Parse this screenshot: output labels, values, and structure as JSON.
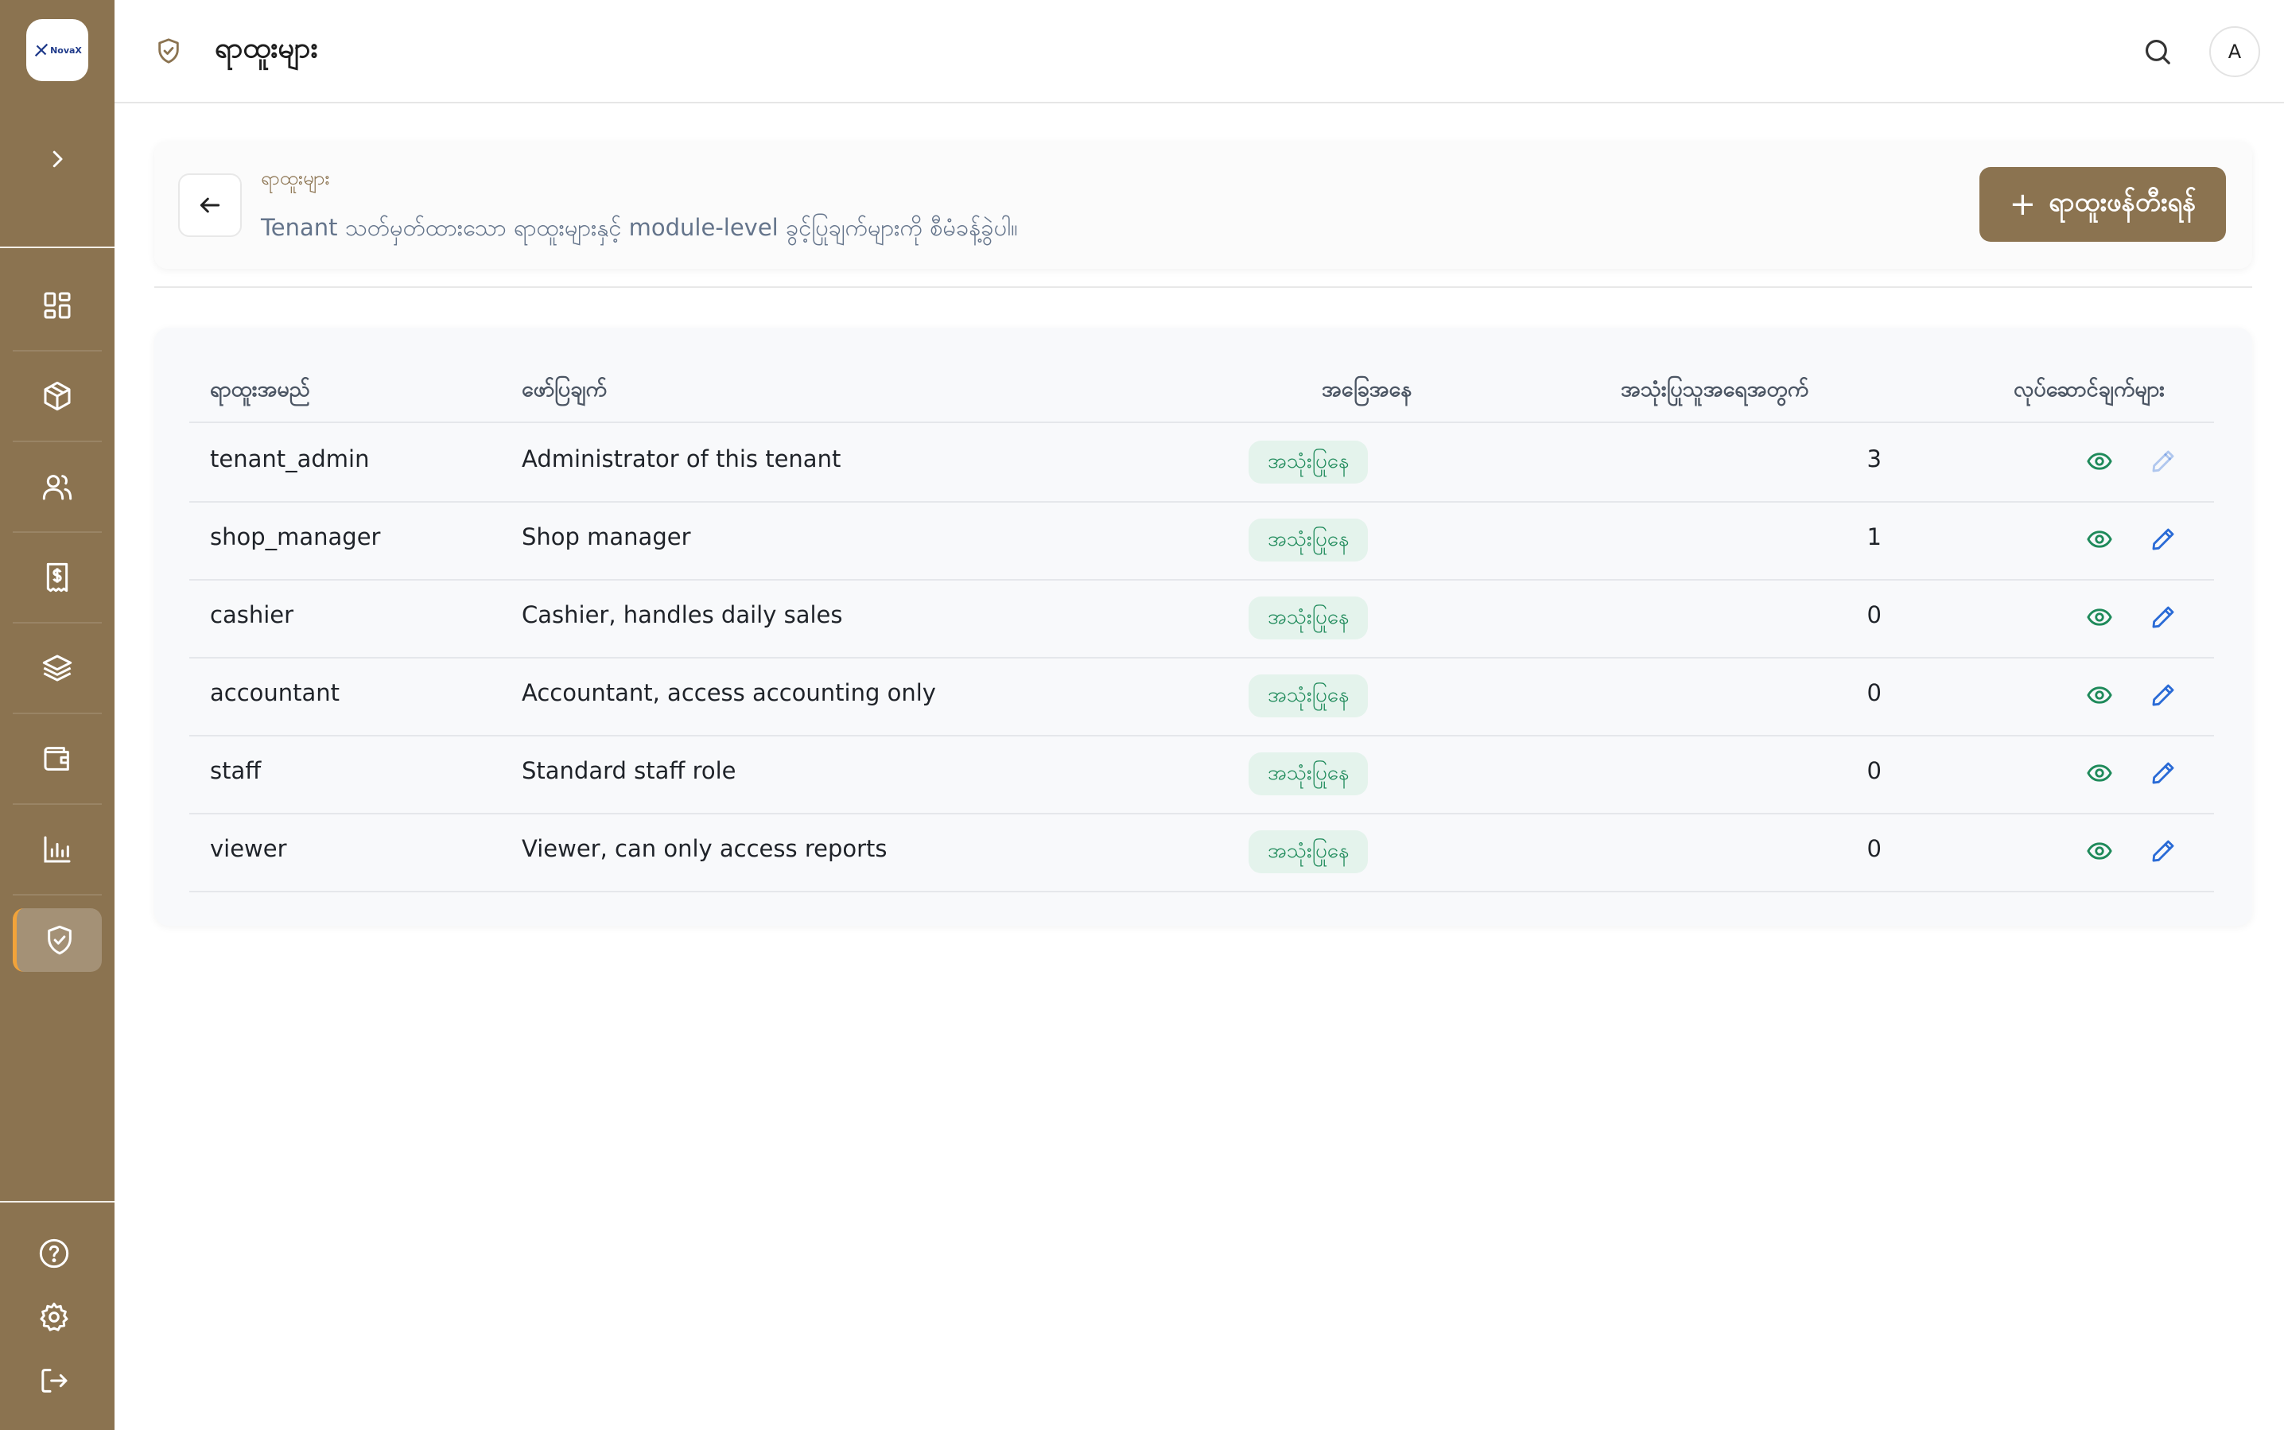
{
  "brand": {
    "logo_text": "NovaX"
  },
  "header": {
    "title": "ရာထူးများ",
    "avatar_initial": "A"
  },
  "page": {
    "breadcrumb": "ရာထူးများ",
    "subtitle": "Tenant သတ်မှတ်ထားသော ရာထူးများနှင့် module-level ခွင့်ပြုချက်များကို စီမံခန့်ခွဲပါ။",
    "create_button_plus": "+",
    "create_button_label": "ရာထူးဖန်တီးရန်"
  },
  "table": {
    "columns": {
      "name": "ရာထူးအမည်",
      "description": "ဖော်ပြချက်",
      "status": "အခြေအနေ",
      "user_count": "အသုံးပြုသူအရေအတွက်",
      "actions": "လုပ်ဆောင်ချက်များ"
    },
    "rows": [
      {
        "name": "tenant_admin",
        "description": "Administrator of this tenant",
        "status": "အသုံးပြုနေ",
        "user_count": "3",
        "edit_enabled": false
      },
      {
        "name": "shop_manager",
        "description": "Shop manager",
        "status": "အသုံးပြုနေ",
        "user_count": "1",
        "edit_enabled": true
      },
      {
        "name": "cashier",
        "description": "Cashier, handles daily sales",
        "status": "အသုံးပြုနေ",
        "user_count": "0",
        "edit_enabled": true
      },
      {
        "name": "accountant",
        "description": "Accountant, access accounting only",
        "status": "အသုံးပြုနေ",
        "user_count": "0",
        "edit_enabled": true
      },
      {
        "name": "staff",
        "description": "Standard staff role",
        "status": "အသုံးပြုနေ",
        "user_count": "0",
        "edit_enabled": true
      },
      {
        "name": "viewer",
        "description": "Viewer, can only access reports",
        "status": "အသုံးပြုနေ",
        "user_count": "0",
        "edit_enabled": true
      }
    ]
  },
  "sidebar": {
    "nav_icons": [
      "dashboard-icon",
      "box-icon",
      "users-icon",
      "receipt-icon",
      "layers-icon",
      "wallet-icon",
      "chart-icon",
      "shield-check-icon"
    ],
    "active": "shield-check-icon",
    "bottom_icons": [
      "help-icon",
      "settings-icon",
      "logout-icon"
    ]
  },
  "colors": {
    "sidebar": "#8b7350",
    "accent_active": "#f2a33a",
    "status_badge_bg": "#e4f3ec",
    "status_badge_text": "#1e8a5a",
    "view_icon": "#1e8a5a",
    "edit_icon": "#2a6bd6"
  }
}
